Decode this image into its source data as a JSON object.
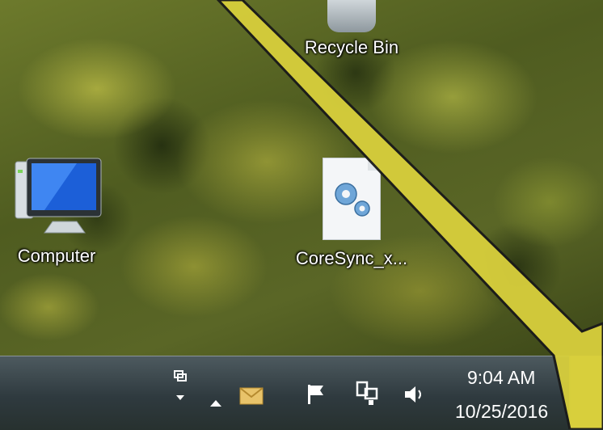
{
  "desktop": {
    "icons": [
      {
        "label": "Recycle Bin",
        "icon": "recycle-bin-icon"
      },
      {
        "label": "Computer",
        "icon": "computer-icon"
      },
      {
        "label": "CoreSync_x...",
        "icon": "settings-file-icon"
      }
    ]
  },
  "taskbar": {
    "tray_icons": [
      "show-hidden-icons-icon",
      "mail-icon",
      "action-center-flag-icon",
      "network-icon",
      "volume-icon"
    ],
    "clock": {
      "time": "9:04 AM",
      "date": "10/25/2016"
    }
  },
  "colors": {
    "callout": "#d8cf3c",
    "callout_border": "#1a1a1a",
    "taskbar": "#2f3a3f"
  }
}
